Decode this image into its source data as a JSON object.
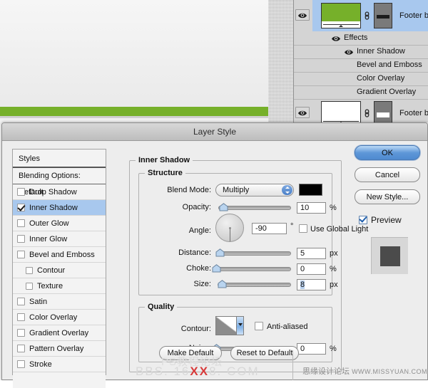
{
  "layers_panel": {
    "layers": [
      {
        "name": "Footer border",
        "visible_icon": "eye-icon",
        "thumb_color": "#76b02a",
        "selected": true,
        "has_link": true,
        "has_mask": true
      },
      {
        "name": "Footer bg",
        "visible_icon": "eye-icon",
        "thumb_color": "#ffffff",
        "selected": false,
        "has_link": true,
        "has_mask": true
      }
    ],
    "effects_group_label": "Effects",
    "effects": [
      {
        "name": "Inner Shadow",
        "visible": true
      },
      {
        "name": "Bevel and Emboss",
        "visible": false
      },
      {
        "name": "Color Overlay",
        "visible": false
      },
      {
        "name": "Gradient Overlay",
        "visible": false
      }
    ]
  },
  "dialog": {
    "title": "Layer Style",
    "styles_panel": {
      "header": "Styles",
      "blending_options": "Blending Options: Default",
      "items": [
        {
          "label": "Drop Shadow",
          "checked": false,
          "sub": false
        },
        {
          "label": "Inner Shadow",
          "checked": true,
          "sub": false,
          "selected": true
        },
        {
          "label": "Outer Glow",
          "checked": false,
          "sub": false
        },
        {
          "label": "Inner Glow",
          "checked": false,
          "sub": false
        },
        {
          "label": "Bevel and Emboss",
          "checked": false,
          "sub": false
        },
        {
          "label": "Contour",
          "checked": false,
          "sub": true
        },
        {
          "label": "Texture",
          "checked": false,
          "sub": true
        },
        {
          "label": "Satin",
          "checked": false,
          "sub": false
        },
        {
          "label": "Color Overlay",
          "checked": false,
          "sub": false
        },
        {
          "label": "Gradient Overlay",
          "checked": false,
          "sub": false
        },
        {
          "label": "Pattern Overlay",
          "checked": false,
          "sub": false
        },
        {
          "label": "Stroke",
          "checked": false,
          "sub": false
        }
      ]
    },
    "panel_title": "Inner Shadow",
    "structure": {
      "title": "Structure",
      "blend_mode_label": "Blend Mode:",
      "blend_mode_value": "Multiply",
      "blend_color": "#000000",
      "opacity_label": "Opacity:",
      "opacity_value": "10",
      "opacity_unit": "%",
      "angle_label": "Angle:",
      "angle_value": "-90",
      "angle_unit": "°",
      "use_global_light_label": "Use Global Light",
      "use_global_light_checked": false,
      "distance_label": "Distance:",
      "distance_value": "5",
      "distance_unit": "px",
      "choke_label": "Choke:",
      "choke_value": "0",
      "choke_unit": "%",
      "size_label": "Size:",
      "size_value": "8",
      "size_unit": "px"
    },
    "quality": {
      "title": "Quality",
      "contour_label": "Contour:",
      "anti_aliased_label": "Anti-aliased",
      "anti_aliased_checked": false,
      "noise_label": "Noise:",
      "noise_value": "0",
      "noise_unit": "%"
    },
    "bottom_buttons": {
      "make_default": "Make Default",
      "reset_to_default": "Reset to Default"
    },
    "right_buttons": {
      "ok": "OK",
      "cancel": "Cancel",
      "new_style": "New Style...",
      "preview_label": "Preview",
      "preview_checked": true
    }
  },
  "watermarks": {
    "line1": "PS教程论坛",
    "line2_pre": "BBS. 16",
    "line2_red": "XX",
    "line2_post": "8. COM",
    "right_cn": "思缘设计论坛",
    "right_url": "WWW.MISSYUAN.COM"
  }
}
